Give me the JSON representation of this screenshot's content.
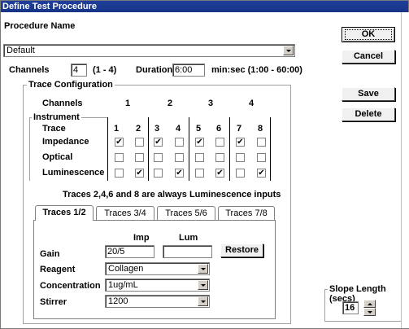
{
  "window": {
    "title": "Define Test Procedure"
  },
  "procedure": {
    "label": "Procedure Name",
    "value": "Default"
  },
  "channels": {
    "label": "Channels",
    "value": "4",
    "range": "(1 - 4)"
  },
  "duration": {
    "label": "Duration",
    "value": "6:00",
    "range": "min:sec (1:00 - 60:00)"
  },
  "buttons": {
    "ok": "OK",
    "cancel": "Cancel",
    "save": "Save",
    "delete": "Delete",
    "restore": "Restore"
  },
  "trace_config": {
    "title": "Trace Configuration",
    "channels_label": "Channels",
    "channel_numbers": [
      "1",
      "2",
      "3",
      "4"
    ],
    "instrument_title": "Instrument",
    "trace_label": "Trace",
    "trace_numbers": [
      "1",
      "2",
      "3",
      "4",
      "5",
      "6",
      "7",
      "8"
    ],
    "rows": [
      {
        "label": "Impedance",
        "checked": [
          true,
          false,
          true,
          false,
          true,
          false,
          true,
          false
        ]
      },
      {
        "label": "Optical",
        "checked": [
          false,
          false,
          false,
          false,
          false,
          false,
          false,
          false
        ]
      },
      {
        "label": "Luminescence",
        "checked": [
          false,
          true,
          false,
          true,
          false,
          true,
          false,
          true
        ]
      }
    ],
    "note": "Traces 2,4,6 and 8 are always Luminescence inputs"
  },
  "tabs": [
    "Traces 1/2",
    "Traces 3/4",
    "Traces 5/6",
    "Traces 7/8"
  ],
  "active_tab": 0,
  "panel": {
    "imp_header": "Imp",
    "lum_header": "Lum",
    "gain_label": "Gain",
    "gain_imp": "20/5",
    "gain_lum": "",
    "reagent_label": "Reagent",
    "reagent_value": "Collagen",
    "concentration_label": "Concentration",
    "concentration_value": "1ug/mL",
    "stirrer_label": "Stirrer",
    "stirrer_value": "1200"
  },
  "slope": {
    "title": "Slope Length (secs)",
    "value": "16"
  }
}
